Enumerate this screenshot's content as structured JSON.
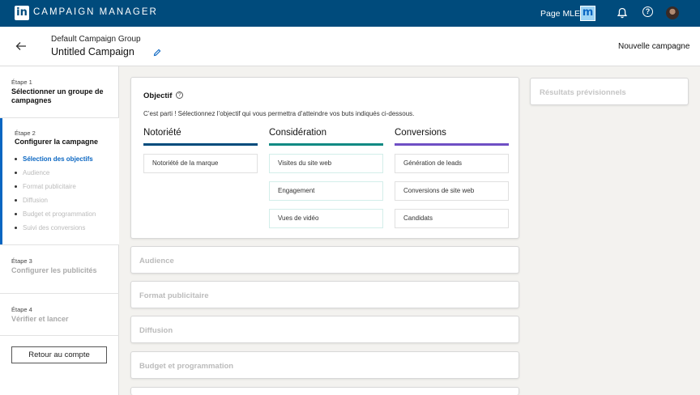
{
  "topbar": {
    "logo": "in",
    "brand": "CAMPAIGN MANAGER",
    "page_name": "Page MLE",
    "page_badge": "m",
    "colors": {
      "bar": "#004b7c",
      "badge": "#9ed4f5"
    }
  },
  "header": {
    "group_name": "Default Campaign Group",
    "campaign_name": "Untitled Campaign",
    "new_campaign": "Nouvelle campagne"
  },
  "sidebar": {
    "step1": {
      "num": "Étape 1",
      "title": "Sélectionner un groupe de campagnes"
    },
    "step2": {
      "num": "Étape 2",
      "title": "Configurer la campagne",
      "substeps": [
        "Sélection des objectifs",
        "Audience",
        "Format publicitaire",
        "Diffusion",
        "Budget et programmation",
        "Suivi des conversions"
      ]
    },
    "step3": {
      "num": "Étape 3",
      "title": "Configurer les publicités"
    },
    "step4": {
      "num": "Étape 4",
      "title": "Vérifier et lancer"
    },
    "back_button": "Retour au compte",
    "active_color": "#0a66c2"
  },
  "objective": {
    "title": "Objectif",
    "description": "C’est parti ! Sélectionnez l’objectif qui vous permettra d’atteindre vos buts indiqués ci-dessous.",
    "columns": [
      {
        "heading": "Notoriété",
        "color": "#004b7c",
        "options": [
          "Notoriété de la marque"
        ]
      },
      {
        "heading": "Considération",
        "color": "#0f8a83",
        "options": [
          "Visites du site web",
          "Engagement",
          "Vues de vidéo"
        ]
      },
      {
        "heading": "Conversions",
        "color": "#6f4fc4",
        "options": [
          "Génération de leads",
          "Conversions de site web",
          "Candidats"
        ]
      }
    ]
  },
  "sections": [
    "Audience",
    "Format publicitaire",
    "Diffusion",
    "Budget et programmation"
  ],
  "forecast": {
    "title": "Résultats prévisionnels"
  }
}
